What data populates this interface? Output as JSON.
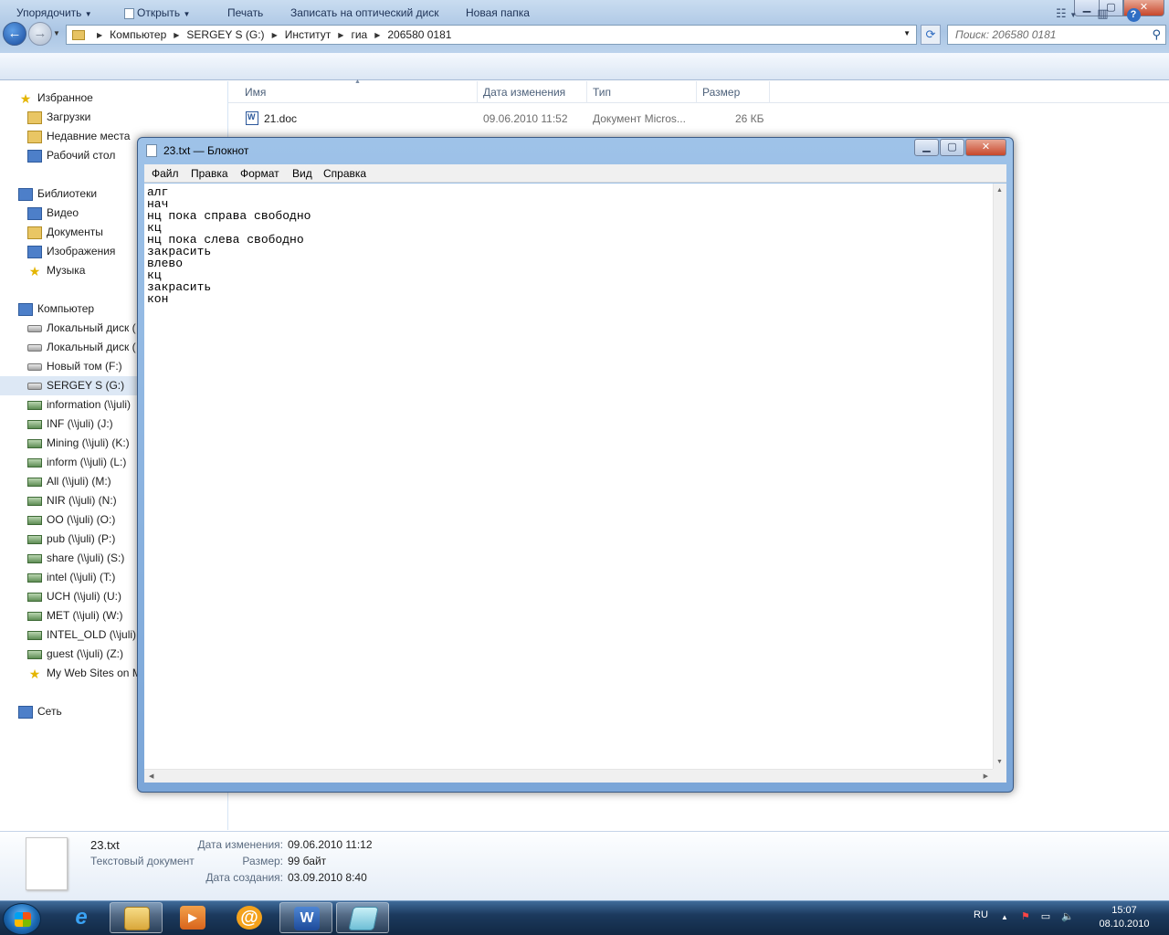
{
  "explorer": {
    "breadcrumb": [
      "Компьютер",
      "SERGEY S (G:)",
      "Институт",
      "гиа",
      "206580 0181"
    ],
    "search_placeholder": "Поиск: 206580 0181",
    "toolbar": {
      "organize": "Упорядочить",
      "open": "Открыть",
      "print": "Печать",
      "burn": "Записать на оптический диск",
      "new_folder": "Новая папка"
    },
    "sidebar": [
      {
        "label": "Избранное",
        "icon": "star-icon",
        "kind": "fav",
        "group": true
      },
      {
        "label": "Загрузки",
        "icon": "downloads-icon",
        "kind": "folder"
      },
      {
        "label": "Недавние места",
        "icon": "recent-places-icon",
        "kind": "folder"
      },
      {
        "label": "Рабочий стол",
        "icon": "desktop-icon",
        "kind": "lib"
      },
      {
        "label": "Библиотеки",
        "icon": "libraries-icon",
        "kind": "lib",
        "group": true
      },
      {
        "label": "Видео",
        "icon": "video-icon",
        "kind": "lib"
      },
      {
        "label": "Документы",
        "icon": "documents-icon",
        "kind": "folder"
      },
      {
        "label": "Изображения",
        "icon": "pictures-icon",
        "kind": "lib"
      },
      {
        "label": "Музыка",
        "icon": "music-icon",
        "kind": "fav"
      },
      {
        "label": "Компьютер",
        "icon": "computer-icon",
        "kind": "lib",
        "group": true
      },
      {
        "label": "Локальный диск (",
        "icon": "drive-icon",
        "kind": "drv"
      },
      {
        "label": "Локальный диск (",
        "icon": "drive-icon",
        "kind": "drv"
      },
      {
        "label": "Новый том (F:)",
        "icon": "drive-icon",
        "kind": "drv"
      },
      {
        "label": "SERGEY S (G:)",
        "icon": "usb-drive-icon",
        "kind": "drv",
        "selected": true
      },
      {
        "label": "information (\\\\juli)",
        "icon": "network-drive-icon",
        "kind": "net"
      },
      {
        "label": "INF (\\\\juli) (J:)",
        "icon": "network-drive-icon",
        "kind": "net"
      },
      {
        "label": "Mining (\\\\juli) (K:)",
        "icon": "network-drive-icon",
        "kind": "net"
      },
      {
        "label": "inform (\\\\juli) (L:)",
        "icon": "network-drive-icon",
        "kind": "net"
      },
      {
        "label": "All (\\\\juli) (M:)",
        "icon": "network-drive-icon",
        "kind": "net"
      },
      {
        "label": "NIR (\\\\juli) (N:)",
        "icon": "network-drive-icon",
        "kind": "net"
      },
      {
        "label": "OO (\\\\juli) (O:)",
        "icon": "network-drive-icon",
        "kind": "net"
      },
      {
        "label": "pub (\\\\juli) (P:)",
        "icon": "network-drive-icon",
        "kind": "net"
      },
      {
        "label": "share (\\\\juli) (S:)",
        "icon": "network-drive-icon",
        "kind": "net"
      },
      {
        "label": "intel (\\\\juli) (T:)",
        "icon": "network-drive-icon",
        "kind": "net"
      },
      {
        "label": "UCH (\\\\juli) (U:)",
        "icon": "network-drive-icon",
        "kind": "net"
      },
      {
        "label": "MET (\\\\juli) (W:)",
        "icon": "network-drive-icon",
        "kind": "net"
      },
      {
        "label": "INTEL_OLD (\\\\juli)",
        "icon": "network-drive-icon",
        "kind": "net"
      },
      {
        "label": "guest (\\\\juli) (Z:)",
        "icon": "network-drive-icon",
        "kind": "net"
      },
      {
        "label": "My Web Sites on M",
        "icon": "msn-icon",
        "kind": "fav"
      },
      {
        "label": "Сеть",
        "icon": "network-icon",
        "kind": "lib",
        "group": true
      }
    ],
    "columns": {
      "name": "Имя",
      "date": "Дата изменения",
      "type": "Тип",
      "size": "Размер"
    },
    "files": [
      {
        "name": "21.doc",
        "date": "09.06.2010 11:52",
        "type": "Документ Micros...",
        "size": "26 КБ"
      }
    ],
    "details": {
      "filename": "23.txt",
      "filetype": "Текстовый документ",
      "modified_label": "Дата изменения:",
      "modified": "09.06.2010 11:12",
      "size_label": "Размер:",
      "size": "99 байт",
      "created_label": "Дата создания:",
      "created": "03.09.2010 8:40"
    }
  },
  "notepad": {
    "title": "23.txt — Блокнот",
    "menu": [
      "Файл",
      "Правка",
      "Формат",
      "Вид",
      "Справка"
    ],
    "text": "алг\nнач\nнц пока справа свободно\nкц\nнц пока слева свободно\nзакрасить\nвлево\nкц\nзакрасить\nкон"
  },
  "taskbar": {
    "lang": "RU",
    "time": "15:07",
    "date": "08.10.2010"
  }
}
